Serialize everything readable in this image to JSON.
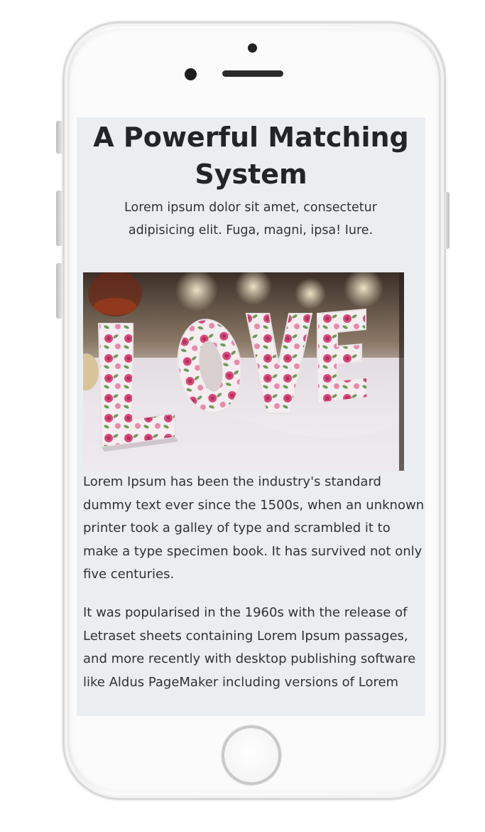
{
  "page": {
    "title": "A Powerful Matching System",
    "lead": "Lorem ipsum dolor sit amet, consectetur adipisicing elit. Fuga, magni, ipsa! Iure.",
    "paragraphs": [
      "Lorem Ipsum has been the industry's standard dummy text ever since the 1500s, when an unknown printer took a galley of type and scrambled it to make a type specimen book. It has survived not only five centuries.",
      "It was popularised in the 1960s with the release of Letraset sheets containing Lorem Ipsum passages, and more recently with desktop publishing software like Aldus PageMaker including versions of Lorem"
    ],
    "hero_image": {
      "letters": [
        "L",
        "O",
        "V",
        "E"
      ]
    }
  },
  "colors": {
    "screen_bg": "#ebeef1",
    "text": "#2f3236",
    "title": "#222428",
    "rose": "#d94a7b",
    "leaf": "#6e9a5a"
  }
}
